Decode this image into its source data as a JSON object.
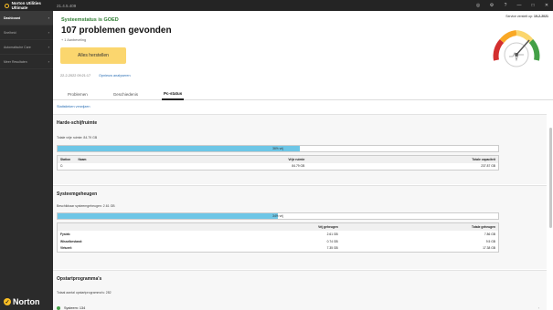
{
  "app": {
    "name": "Norton Utilities Ultimate",
    "version": "21.4.5.409"
  },
  "titlebar": {
    "icons": [
      "globe-icon",
      "gear-icon",
      "help-icon"
    ],
    "minimize": "—",
    "maximize": "□",
    "close": "✕"
  },
  "sidebar": {
    "items": [
      {
        "label": "Dashboard",
        "active": true
      },
      {
        "label": "Snelheid",
        "active": false
      },
      {
        "label": "Automatische Care",
        "active": false
      },
      {
        "label": "Meer Resultaten",
        "active": false
      }
    ],
    "logo_text": "Norton"
  },
  "header": {
    "status_title": "Systeemstatus is GOED",
    "problems": "107 problemen gevonden",
    "subline": "+ 1 Aanbeveling",
    "fix_button": "Alles herstellen",
    "datetime": "22-2-2022 09:21:17",
    "analyze_link": "Opnieuw analyseren",
    "service_label": "Service verstelt op:",
    "service_date": "19-2-2021"
  },
  "tabs": [
    {
      "label": "Problemen",
      "active": false
    },
    {
      "label": "Geschiedenis",
      "active": false
    },
    {
      "label": "Pc-status",
      "active": true
    }
  ],
  "details_link": "Statistieken verwijzen",
  "disk": {
    "title": "Harde-schijfruimte",
    "free_text": "Totale vrije ruimte: 84.79 GB",
    "bar_percent": 36,
    "bar_text": "36% vrij",
    "columns": [
      "Station",
      "Naam",
      "Vrije ruimte",
      "Totale capaciteit"
    ],
    "rows": [
      [
        "C:",
        "",
        "84.79 GB",
        "237.87 GB"
      ]
    ]
  },
  "memory": {
    "title": "Systeemgeheugen",
    "avail_text": "Beschikbaar systeemgeheugen: 2.61 GB",
    "bar_percent": 34,
    "bar_text": "34% vrij",
    "columns": [
      "",
      "Vrij geheugen",
      "Totale geheugen"
    ],
    "rows": [
      [
        "Fysiek:",
        "2.61 GB",
        "7.86 GB"
      ],
      [
        "Wisselbestand:",
        "0.74 GB",
        "9.5 GB"
      ],
      [
        "Virtueel:",
        "7.35 GB",
        "17.38 GB"
      ]
    ]
  },
  "startup": {
    "title": "Opstartprogramma's",
    "count_text": "Totaal aantal opstartprogramma's: 282",
    "row_label": "Systeem: 134"
  },
  "colors": {
    "accent": "#fbd66e",
    "good": "#2e7d32",
    "bar": "#6ec6e6",
    "link": "#2a6fb5"
  }
}
